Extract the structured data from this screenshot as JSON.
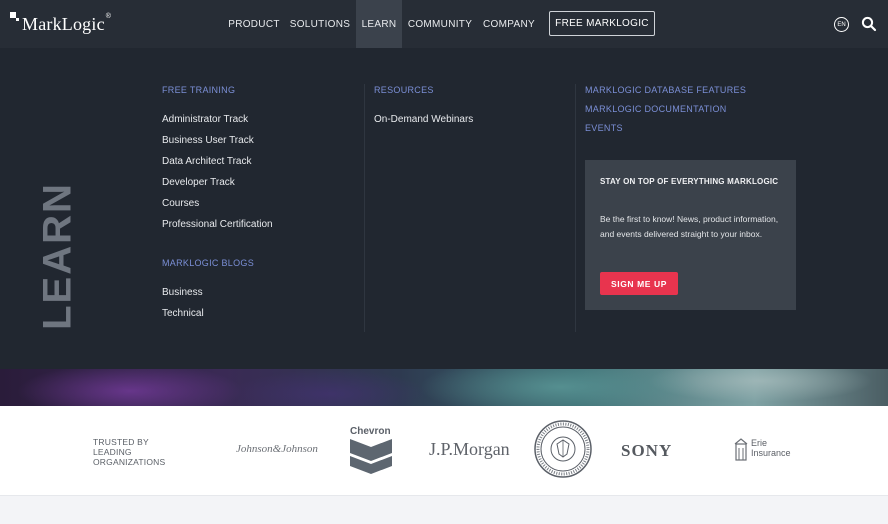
{
  "header": {
    "logo_text": "MarkLogic",
    "logo_reg": "®",
    "nav": [
      {
        "label": "PRODUCT"
      },
      {
        "label": "SOLUTIONS"
      },
      {
        "label": "LEARN"
      },
      {
        "label": "COMMUNITY"
      },
      {
        "label": "COMPANY"
      }
    ],
    "cta_label": "FREE MARKLOGIC",
    "lang_label": "EN",
    "active_nav": "LEARN"
  },
  "mega": {
    "big_title": "LEARN",
    "col1": {
      "heading": "FREE TRAINING",
      "links": [
        "Administrator Track",
        "Business User Track",
        "Data Architect Track",
        "Developer Track",
        "Courses",
        "Professional Certification"
      ],
      "heading2": "MARKLOGIC BLOGS",
      "links2": [
        "Business",
        "Technical"
      ]
    },
    "col2": {
      "heading": "RESOURCES",
      "links": [
        "On-Demand Webinars"
      ]
    },
    "col3": {
      "headings": [
        "MARKLOGIC DATABASE FEATURES",
        "MARKLOGIC DOCUMENTATION",
        "EVENTS"
      ]
    },
    "signup": {
      "title": "STAY ON TOP OF EVERYTHING MARKLOGIC",
      "body": "Be the first to know! News, product information, and events delivered straight to your inbox.",
      "button": "SIGN ME UP"
    }
  },
  "logos": {
    "trusted": [
      "TRUSTED BY",
      "LEADING",
      "ORGANIZATIONS"
    ],
    "brands": {
      "jnj": "Johnson&Johnson",
      "chevron": "Chevron",
      "jpm": "J.P.Morgan",
      "sony": "SONY",
      "erie": [
        "Erie",
        "Insurance"
      ]
    }
  },
  "colors": {
    "header_bg": "#272d36",
    "mega_bg": "#212730",
    "accent_link": "#7b8fd6",
    "cta_red": "#e8344e"
  }
}
